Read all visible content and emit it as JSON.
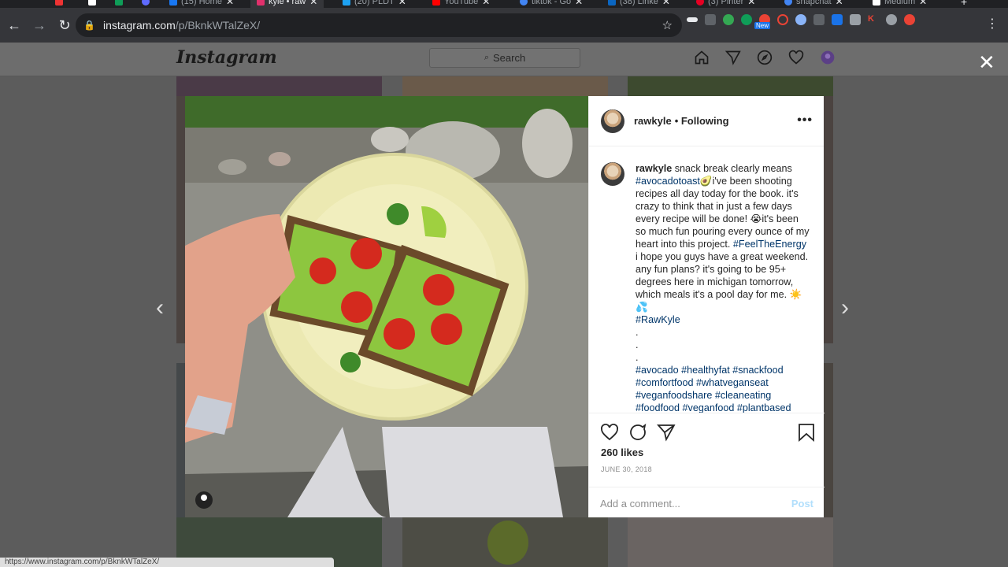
{
  "browser": {
    "tabs": [
      {
        "label": "(15) Home",
        "favicon_color": "#f4f4f4"
      },
      {
        "label": "kyle • raw",
        "favicon_color": "#e1306c",
        "active": true
      },
      {
        "label": "(20) PLDT",
        "favicon_color": "#1da1f2"
      },
      {
        "label": "YouTube",
        "favicon_color": "#ff0000"
      },
      {
        "label": "tiktok - Go",
        "favicon_color": "#4285f4"
      },
      {
        "label": "(38) Linke",
        "favicon_color": "#0a66c2"
      },
      {
        "label": "(3) Pinter",
        "favicon_color": "#e60023"
      },
      {
        "label": "snapchat",
        "favicon_color": "#4285f4"
      },
      {
        "label": "Medium",
        "favicon_color": "#ffffff"
      }
    ],
    "url_host": "instagram.com",
    "url_path": "/p/BknkWTalZeX/",
    "new_badge": "New",
    "status_url": "https://www.instagram.com/p/BknkWTalZeX/"
  },
  "instagram": {
    "logo": "Instagram",
    "search_placeholder": "Search"
  },
  "post": {
    "username": "rawkyle",
    "follow_state": "• Following",
    "caption_segments": [
      {
        "text": "snack break clearly means ",
        "tag": false
      },
      {
        "text": "#avocadotoast",
        "tag": true
      },
      {
        "text": "🥑i've been shooting recipes all day today for the book. it's crazy to think that in just a few days every recipe will be done! 😭it's been so much fun pouring every ounce of my heart into this project. ",
        "tag": false
      },
      {
        "text": "#FeelTheEnergy",
        "tag": true
      },
      {
        "text": " i hope you guys have a great weekend. any fun plans? it's going to be 95+ degrees here in michigan tomorrow, which meals it's a pool day for me. ☀️💦\n",
        "tag": false
      },
      {
        "text": "#RawKyle",
        "tag": true
      },
      {
        "text": "\n.\n.\n.\n",
        "tag": false
      },
      {
        "text": "#avocado #healthyfat #snackfood #comfortfood #whatveganseat #veganfoodshare #cleaneating #foodfood #veganfood #plantbased",
        "tag": true
      }
    ],
    "likes": "260 likes",
    "date": "JUNE 30, 2018",
    "comment_placeholder": "Add a comment...",
    "post_label": "Post"
  }
}
